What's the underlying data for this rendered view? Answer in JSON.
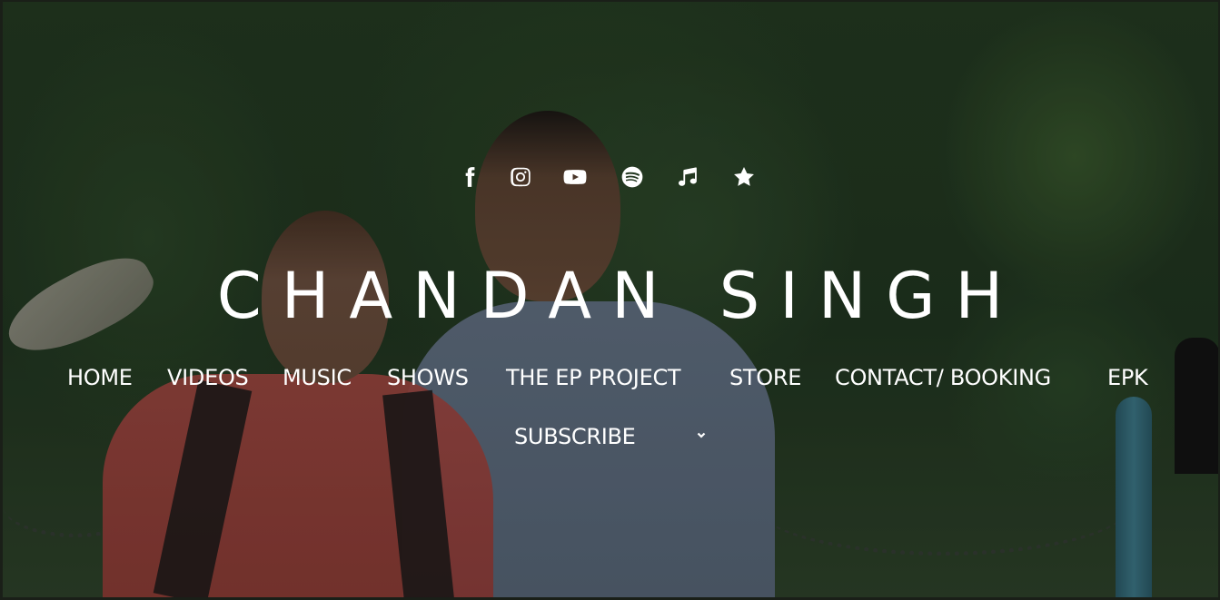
{
  "site": {
    "title": "CHANDAN SINGH"
  },
  "social_icons": [
    {
      "name": "facebook-icon"
    },
    {
      "name": "instagram-icon"
    },
    {
      "name": "youtube-icon"
    },
    {
      "name": "spotify-icon"
    },
    {
      "name": "music-note-icon"
    },
    {
      "name": "star-icon"
    }
  ],
  "nav": {
    "items": [
      {
        "label": "HOME"
      },
      {
        "label": "VIDEOS"
      },
      {
        "label": "MUSIC"
      },
      {
        "label": "SHOWS"
      },
      {
        "label": "THE EP PROJECT"
      },
      {
        "label": "STORE"
      },
      {
        "label": "CONTACT/ BOOKING"
      },
      {
        "label": "EPK"
      },
      {
        "label": "SUBSCRIBE"
      }
    ],
    "submenu_icon": "chevron-down-icon"
  },
  "colors": {
    "text": "#ffffff",
    "overlay": "#000000"
  }
}
